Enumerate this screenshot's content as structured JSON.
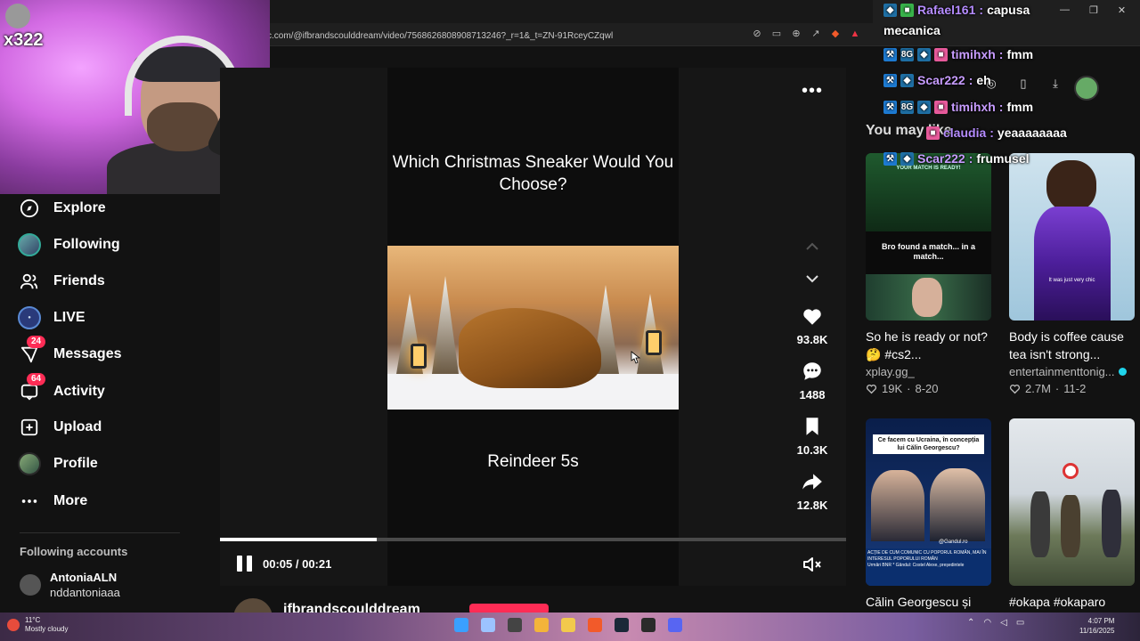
{
  "browser": {
    "url": "c.com/@ifbrandscoulddream/video/7568626808908713246?_r=1&_t=ZN-91RceyCZqwl"
  },
  "webcam": {
    "counter": "x322"
  },
  "sidebar": {
    "items": [
      {
        "label": "Explore",
        "icon": "compass-icon"
      },
      {
        "label": "Following",
        "icon": "avatar"
      },
      {
        "label": "Friends",
        "icon": "friends-icon"
      },
      {
        "label": "LIVE",
        "icon": "live-icon"
      },
      {
        "label": "Messages",
        "icon": "messages-icon",
        "badge": "24"
      },
      {
        "label": "Activity",
        "icon": "activity-icon",
        "badge": "64"
      },
      {
        "label": "Upload",
        "icon": "upload-icon"
      },
      {
        "label": "Profile",
        "icon": "avatar"
      },
      {
        "label": "More",
        "icon": "more-icon"
      }
    ],
    "following_header": "Following accounts",
    "following_accounts": [
      {
        "name": "AntoniaALN",
        "handle": "nddantoniaaa"
      }
    ]
  },
  "video": {
    "question": "Which Christmas Sneaker Would You Choose?",
    "caption": "Reindeer 5s",
    "time": "00:05 / 00:21",
    "progress": 0.25,
    "author": "ifbrandscoulddream",
    "actions": [
      {
        "name": "like",
        "count": "93.8K"
      },
      {
        "name": "comment",
        "count": "1488"
      },
      {
        "name": "save",
        "count": "10.3K"
      },
      {
        "name": "share",
        "count": "12.8K"
      }
    ]
  },
  "right": {
    "title": "You may like",
    "cards": [
      {
        "title": "So he is ready or not?🤔 #cs2...",
        "creator": "xplay.gg_",
        "likes": "19K",
        "date": "8-20",
        "thumb_text_1": "YOUR MATCH IS READY!",
        "thumb_text_2": "Bro found a match... in a match..."
      },
      {
        "title": "Body is coffee cause tea isn't strong...",
        "creator": "entertainmenttonig...",
        "likes": "2.7M",
        "date": "11-2",
        "thumb_text_1": "It was just very chic"
      },
      {
        "title": "Călin Georgescu și",
        "creator": "",
        "likes": "",
        "date": "",
        "thumb_text_1": "Ce facem cu Ucraina, în concepția lui Călin Georgescu?",
        "thumb_text_2": "@Gandul.ro",
        "thumb_text_3": "ACȚIE DE CUM COMUNIC CU POPORUL ROMÂN, MAI ÎN INTERESUL POPORULUI ROMÂN",
        "thumb_text_4": "Urmări BNR * Gândul: Costel Alexe, președintele"
      },
      {
        "title": "#okapa #okaparo",
        "creator": "",
        "likes": "",
        "date": ""
      }
    ]
  },
  "chat": [
    {
      "user": "Rafael161",
      "text": "capusa",
      "color": "#b58cff"
    },
    {
      "user": "",
      "text": "mecanica",
      "color": "#ffffff"
    },
    {
      "user": "timihxh",
      "text": "fmm",
      "color": "#c79cff"
    },
    {
      "user": "Scar222",
      "text": "eh",
      "color": "#c79cff"
    },
    {
      "user": "timihxh",
      "text": "fmm",
      "color": "#c79cff"
    },
    {
      "user": "claudia",
      "text": "yeaaaaaaaa",
      "color": "#b58cff"
    },
    {
      "user": "Scar222",
      "text": "frumusel",
      "color": "#c79cff"
    }
  ],
  "taskbar": {
    "temp": "11°C",
    "weather": "Mostly cloudy",
    "time": "4:07 PM",
    "date": "11/16/2025"
  },
  "colors": {
    "accent": "#fe2c55",
    "background": "#121212"
  }
}
